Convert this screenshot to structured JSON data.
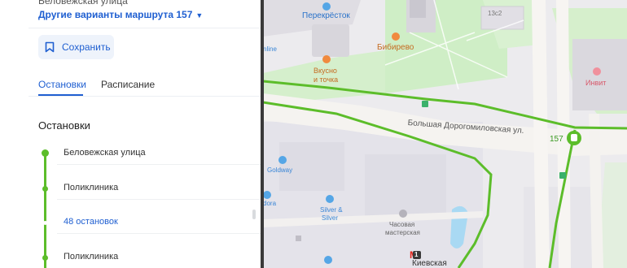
{
  "panel": {
    "route_subtitle": "Беловежская улица",
    "route_variants_label": "Другие варианты маршрута 157",
    "route_variants_caret": "▼",
    "save_label": "Сохранить",
    "tabs": [
      {
        "label": "Остановки",
        "active": true
      },
      {
        "label": "Расписание",
        "active": false
      }
    ],
    "section_title": "Остановки",
    "stops": [
      {
        "name": "Беловежская улица",
        "kind": "stop"
      },
      {
        "name": "Поликлиника",
        "kind": "stop"
      },
      {
        "name": "48 остановок",
        "kind": "collapsed"
      },
      {
        "name": "Поликлиника",
        "kind": "stop"
      }
    ]
  },
  "map": {
    "street_label": "Большая Дорогомиловская ул.",
    "route_number": "157",
    "pois": {
      "perekrestok": "Перекрёсток",
      "vkusno": "Вкусно",
      "vkusno2": "и точка",
      "bibirevo": "Бибирево",
      "building": "13с2",
      "goldway": "Goldway",
      "silver1": "Silver &",
      "silver2": "Silver",
      "clock1": "Часовая",
      "clock2": "мастерская",
      "metro": "Киевская",
      "metro_line": "1",
      "invitro": "Инвит",
      "online": "nline",
      "ora": "dora"
    },
    "colors": {
      "route": "#5cbd2a",
      "accent": "#1f5fd1",
      "poi_blue": "#55a6e6",
      "poi_orange": "#f08a3e",
      "park": "#cfeec6"
    }
  }
}
